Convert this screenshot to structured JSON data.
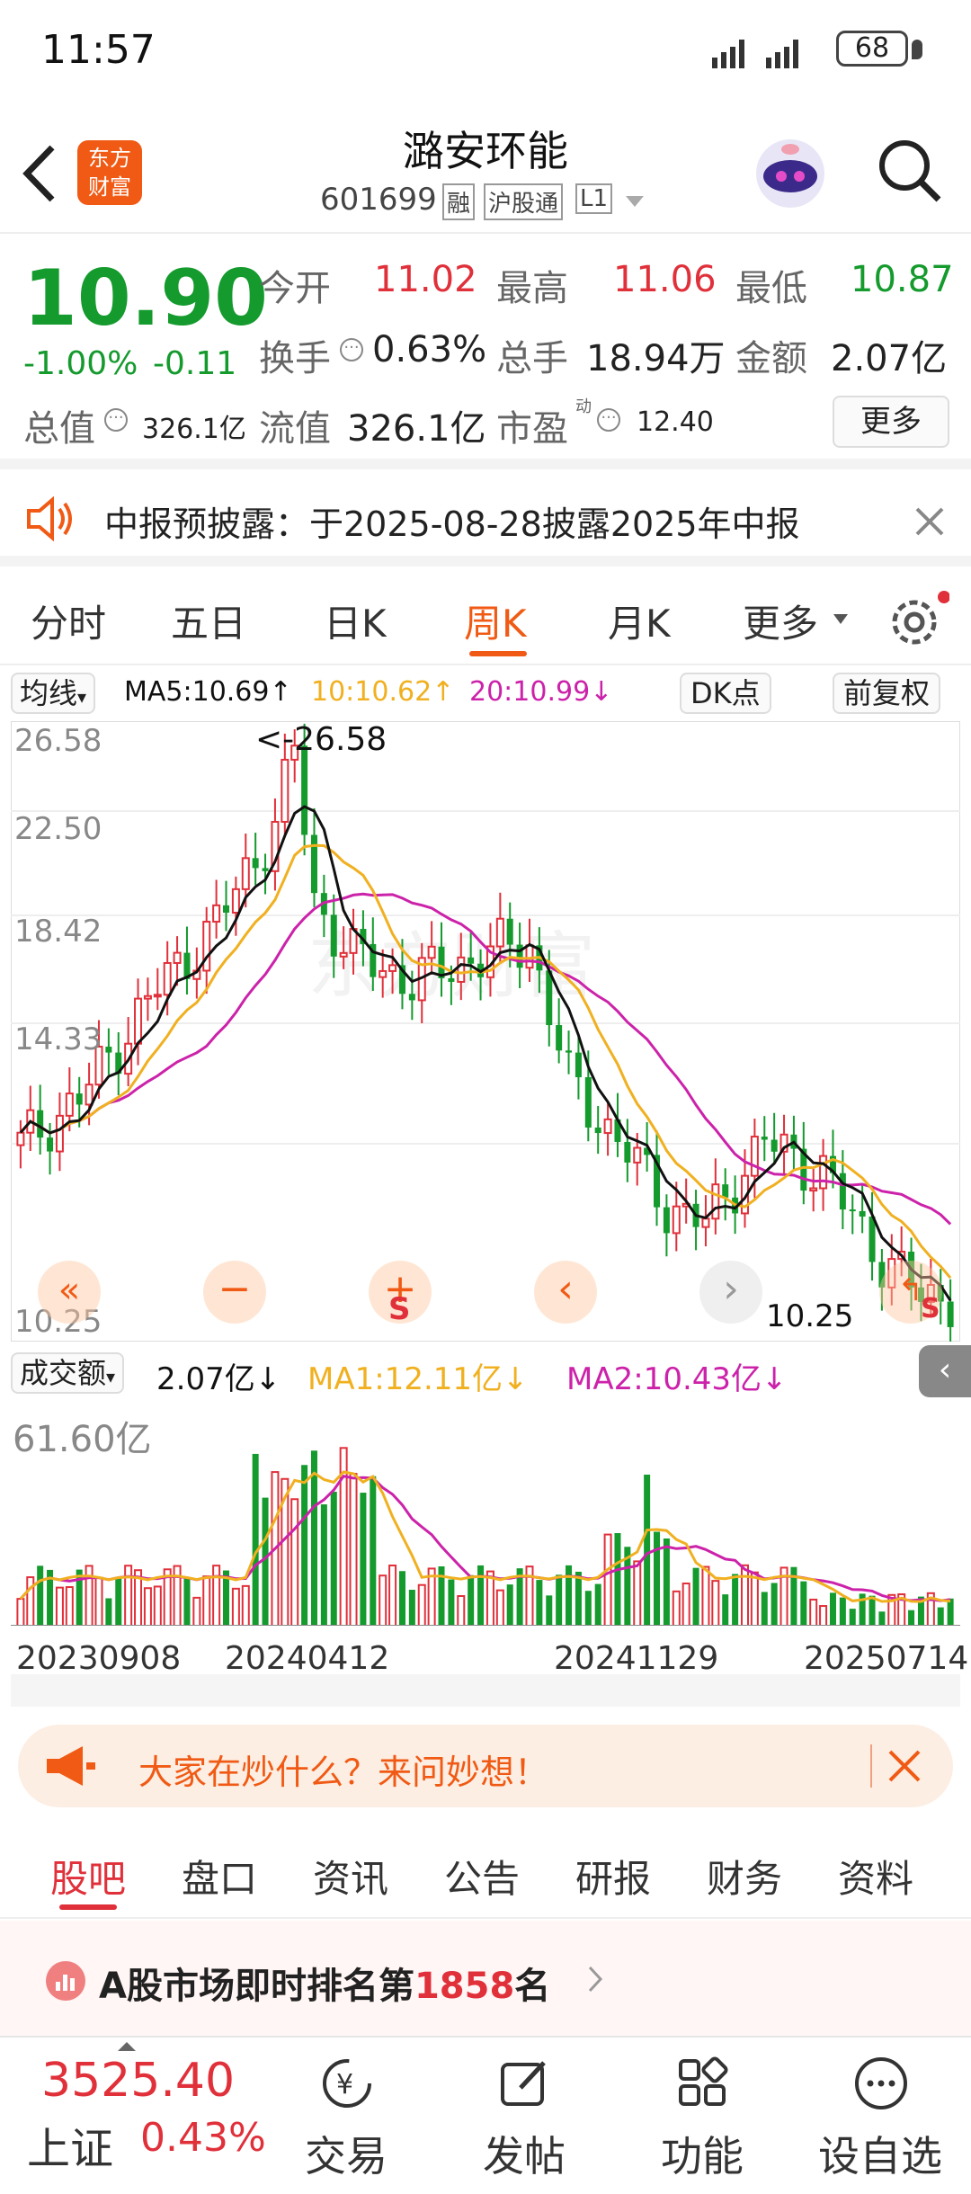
{
  "status_bar": {
    "time": "11:57",
    "battery": "68"
  },
  "header": {
    "title": "潞安环能",
    "code": "601699",
    "badges": [
      "融",
      "沪股通",
      "L1"
    ]
  },
  "quote": {
    "price": "10.90",
    "change_pct": "-1.00%",
    "change_amt": "-0.11",
    "open_label": "今开",
    "open": "11.02",
    "high_label": "最高",
    "high": "11.06",
    "low_label": "最低",
    "low": "10.87",
    "turnover_label": "换手",
    "turnover": "0.63%",
    "volume_label": "总手",
    "volume": "18.94万",
    "amount_label": "金额",
    "amount": "2.07亿",
    "mktcap_label": "总值",
    "mktcap": "326.1亿",
    "float_label": "流值",
    "float_cap": "326.1亿",
    "pe_label": "市盈",
    "pe_sup": "动",
    "pe": "12.40",
    "more_label": "更多"
  },
  "notice": {
    "text": "中报预披露：于2025-08-28披露2025年中报"
  },
  "tabs": {
    "items": [
      "分时",
      "五日",
      "日K",
      "周K",
      "月K",
      "更多"
    ],
    "active": "周K"
  },
  "ma_legend": {
    "select": "均线",
    "ma5": "MA5:10.69↑",
    "ma10": "10:10.62↑",
    "ma20": "20:10.99↓",
    "dk": "DK点",
    "adjust": "前复权"
  },
  "kline_labels": {
    "y_ticks": [
      "26.58",
      "22.50",
      "18.42",
      "14.33",
      "10.25"
    ],
    "max_mark": "<-26.58",
    "min_mark": "10.25",
    "sell_mark": "S"
  },
  "vol_legend": {
    "select": "成交额",
    "vol": "2.07亿↓",
    "ma1": "MA1:12.11亿↓",
    "ma2": "MA2:10.43亿↓",
    "max_label": "61.60亿"
  },
  "dates": [
    "20230908",
    "20240412",
    "20241129",
    "20250714"
  ],
  "ask": {
    "text": "大家在炒什么？来问妙想！"
  },
  "sub_tabs": {
    "items": [
      "股吧",
      "盘口",
      "资讯",
      "公告",
      "研报",
      "财务",
      "资料"
    ],
    "active": "股吧"
  },
  "rank": {
    "prefix": "A股市场即时排名第",
    "number": "1858",
    "suffix": "名"
  },
  "bottom_bar": {
    "index_value": "3525.40",
    "index_name": "上证",
    "index_change": "0.43%",
    "items": [
      "交易",
      "发帖",
      "功能",
      "设自选"
    ]
  },
  "colors": {
    "up": "#e0303a",
    "down": "#149a2d",
    "ma5": "#111111",
    "ma10": "#f0b020",
    "ma20": "#cc22aa",
    "accent": "#f05a14"
  }
}
